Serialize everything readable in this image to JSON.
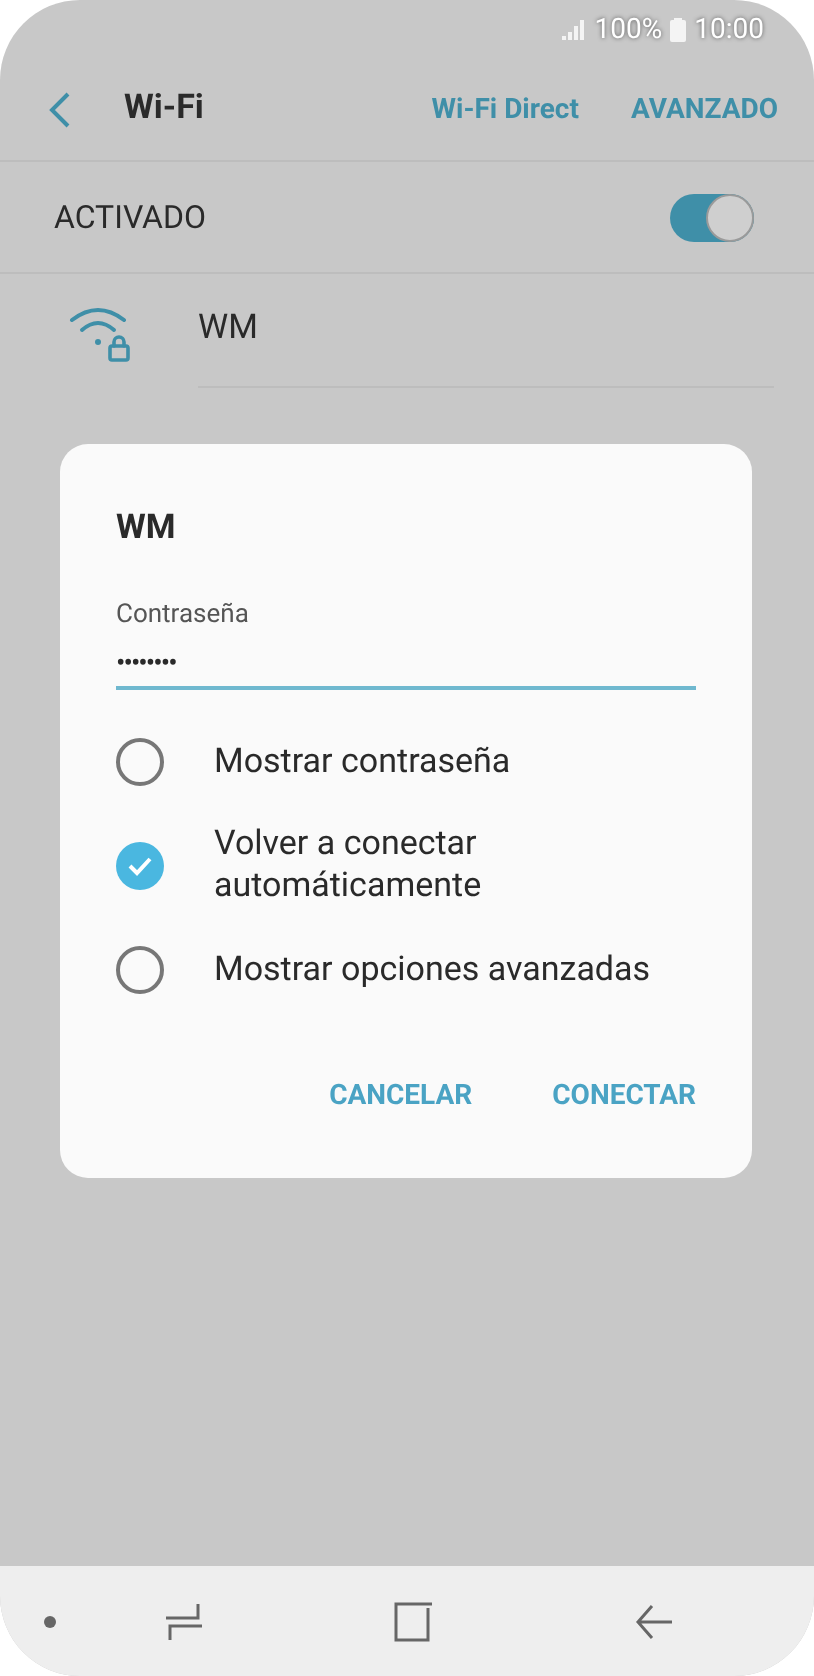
{
  "status_bar": {
    "battery": "100%",
    "time": "10:00"
  },
  "header": {
    "title": "Wi-Fi",
    "actions": [
      "Wi-Fi Direct",
      "AVANZADO"
    ]
  },
  "master_switch": {
    "label": "ACTIVADO",
    "on": true
  },
  "networks": [
    {
      "name": "WM",
      "locked": true
    }
  ],
  "dialog": {
    "title": "WM",
    "password": {
      "label": "Contraseña",
      "value": "••••••••"
    },
    "options": [
      {
        "label": "Mostrar contraseña",
        "checked": false
      },
      {
        "label": "Volver a conectar automáticamente",
        "checked": true
      },
      {
        "label": "Mostrar opciones avanzadas",
        "checked": false
      }
    ],
    "buttons": [
      "CANCELAR",
      "CONECTAR"
    ]
  }
}
